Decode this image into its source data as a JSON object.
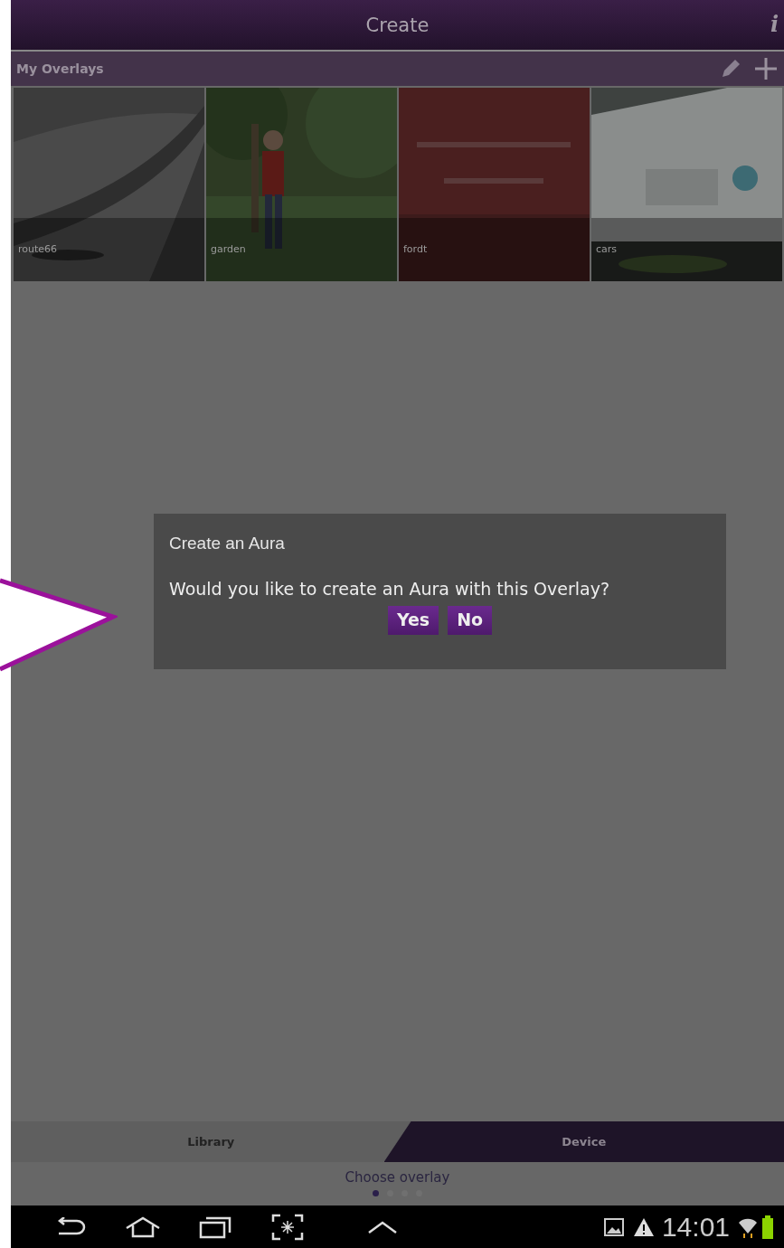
{
  "title_bar": {
    "title": "Create",
    "info": "i"
  },
  "overlays_bar": {
    "title": "My Overlays"
  },
  "overlays": [
    {
      "label": "route66",
      "kind": "picture"
    },
    {
      "label": "garden",
      "kind": "picture"
    },
    {
      "label": "fordt",
      "kind": "picture"
    },
    {
      "label": "cars",
      "kind": "picture"
    }
  ],
  "dialog": {
    "title": "Create an Aura",
    "message": "Would you like to create an Aura with this Overlay?",
    "buttons": [
      "Yes",
      "No"
    ]
  },
  "tabs": [
    {
      "label": "Library",
      "selected": true
    },
    {
      "label": "Device",
      "selected": false
    }
  ],
  "caption": "Choose overlay",
  "pager": [
    {
      "selected": true
    },
    {
      "selected": false
    },
    {
      "selected": false
    },
    {
      "selected": false
    }
  ],
  "status_bar": {
    "time": "14:01"
  }
}
